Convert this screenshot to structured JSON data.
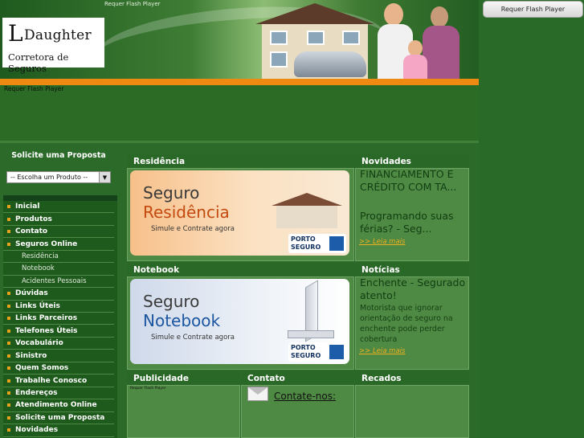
{
  "header": {
    "logo_initial": "L",
    "logo_name": "Daughter",
    "logo_subtitle": "Corretora de Seguros",
    "flash_top": "Requer Flash Player",
    "flash_banner": "Requer Flash Player"
  },
  "right_column": {
    "flash_button": "Requer Flash Player"
  },
  "sidebar": {
    "proposal_title": "Solicite uma Proposta",
    "product_select": {
      "value": "-- Escolha um Produto --"
    },
    "menu": [
      {
        "label": "Inicial",
        "sub": false
      },
      {
        "label": "Produtos",
        "sub": false
      },
      {
        "label": "Contato",
        "sub": false
      },
      {
        "label": "Seguros Online",
        "sub": false
      },
      {
        "label": "Residência",
        "sub": true
      },
      {
        "label": "Notebook",
        "sub": true
      },
      {
        "label": "Acidentes Pessoais",
        "sub": true
      },
      {
        "label": "Dúvidas",
        "sub": false
      },
      {
        "label": "Links Úteis",
        "sub": false
      },
      {
        "label": "Links Parceiros",
        "sub": false
      },
      {
        "label": "Telefones Úteis",
        "sub": false
      },
      {
        "label": "Vocabulário",
        "sub": false
      },
      {
        "label": "Sinistro",
        "sub": false
      },
      {
        "label": "Quem Somos",
        "sub": false
      },
      {
        "label": "Trabalhe Conosco",
        "sub": false
      },
      {
        "label": "Endereços",
        "sub": false
      },
      {
        "label": "Atendimento Online",
        "sub": false
      },
      {
        "label": "Solicite uma Proposta",
        "sub": false
      },
      {
        "label": "Novidades",
        "sub": false
      }
    ]
  },
  "sections": {
    "residencia": {
      "title": "Residência",
      "banner_line1": "Seguro",
      "banner_line2": "Residência",
      "banner_sub": "Simule e Contrate agora",
      "brand_line1": "PORTO",
      "brand_line2": "SEGURO"
    },
    "notebook": {
      "title": "Notebook",
      "banner_line1": "Seguro",
      "banner_line2": "Notebook",
      "banner_sub": "Simule e Contrate agora",
      "brand_line1": "PORTO",
      "brand_line2": "SEGURO"
    },
    "novidades": {
      "title": "Novidades",
      "item1": "FINANCIAMENTO E CRÉDITO COM TA...",
      "item2": "Programando suas férias? - Seg...",
      "more": ">> Leia mais"
    },
    "noticias": {
      "title": "Notícias",
      "headline": "Enchente - Segurado atento!",
      "text": "Motorista que ignorar orientação de seguro na enchente pode perder cobertura",
      "more": ">> Leia mais"
    },
    "publicidade": {
      "title": "Publicidade",
      "flash": "Requer Flash Player"
    },
    "contato": {
      "title": "Contato",
      "link": "Contate-nos:"
    },
    "recados": {
      "title": "Recados"
    }
  },
  "colors": {
    "page_green": "#2c6a2a",
    "panel_green": "#4e8a43",
    "accent_orange": "#ee8a12",
    "link_yellow": "#f0b020"
  }
}
